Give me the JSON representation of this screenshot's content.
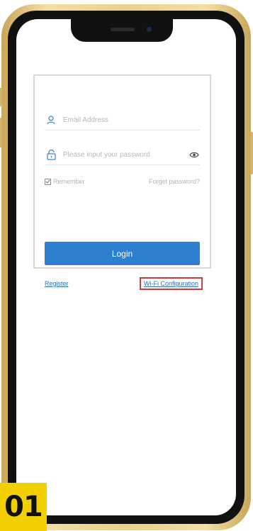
{
  "login": {
    "email_placeholder": "Email Address",
    "email_value": "",
    "password_placeholder": "Please input your password",
    "password_value": "",
    "remember_label": "Remember",
    "forgot_label": "Forget password?",
    "login_label": "Login",
    "register_label": "Register",
    "wifi_config_label": "Wi-Fi Configuration"
  },
  "step_badge": "01",
  "icons": {
    "email": "user-icon",
    "password": "unlock-icon",
    "eye": "eye-icon",
    "checkbox": "checkbox-checked-icon"
  },
  "colors": {
    "accent": "#2f7fd0",
    "link": "#2f6db7",
    "highlight_box": "#d23a3a",
    "badge": "#f2cf00"
  }
}
